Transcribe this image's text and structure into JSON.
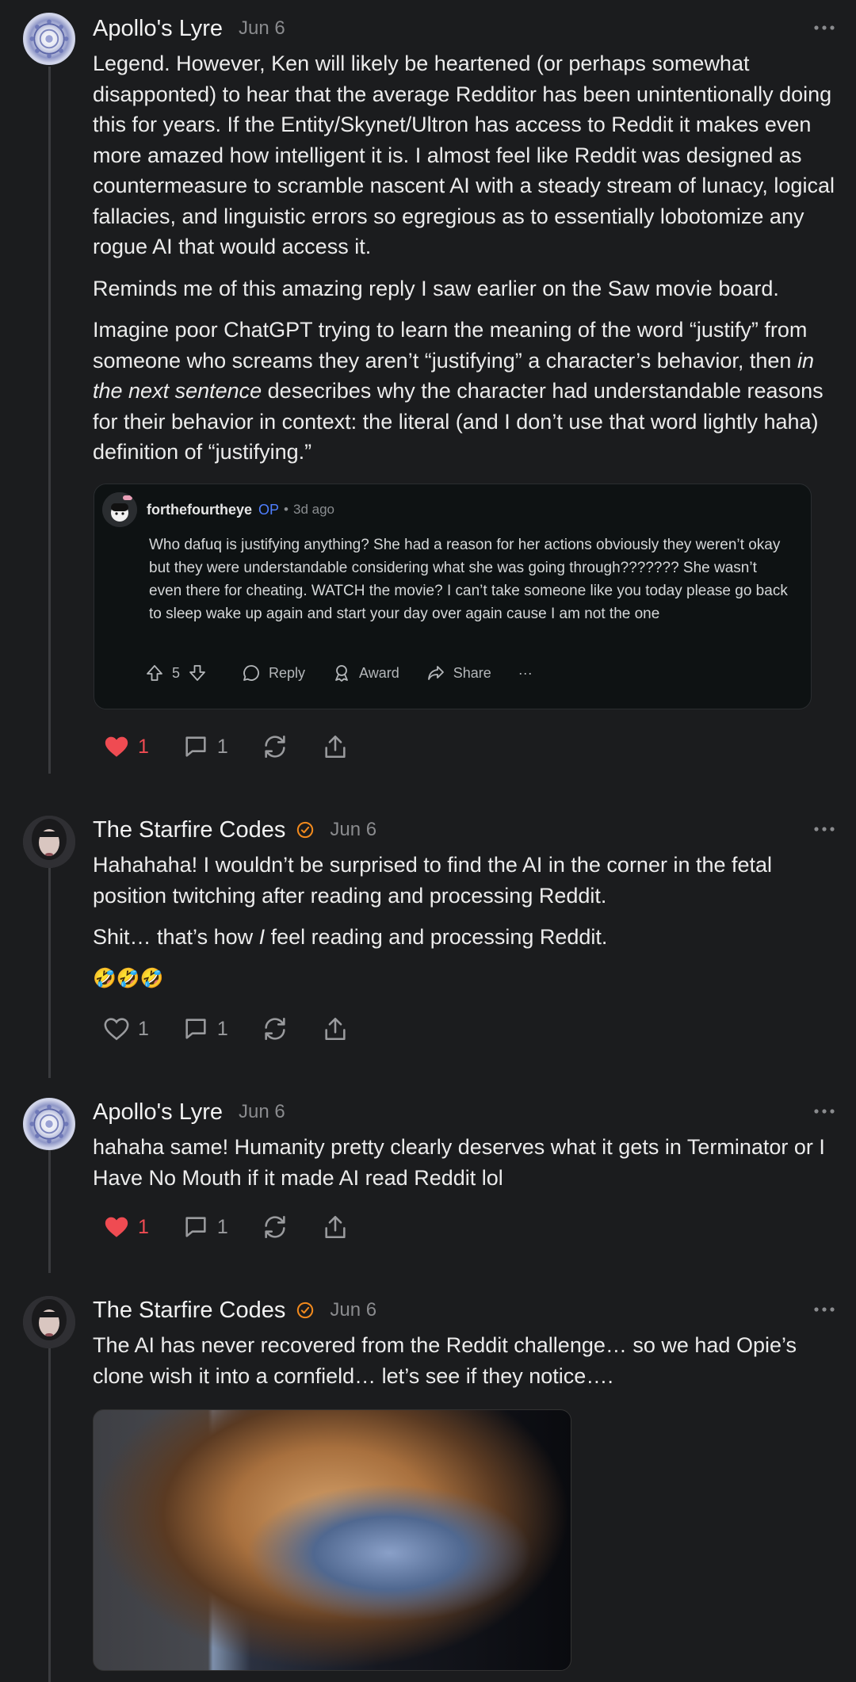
{
  "colors": {
    "background": "#1b1c1e",
    "like": "#ef4b52",
    "op": "#4f7fff",
    "verified": "#f28a1d"
  },
  "comments": [
    {
      "author": "Apollo's Lyre",
      "date": "Jun 6",
      "paragraphs": [
        "Legend. However, Ken will likely be heartened (or perhaps somewhat disapponted) to hear that the average Redditor has been unintentionally doing this for years. If the Entity/Skynet/Ultron has access to Reddit it makes even more amazed how intelligent it is. I almost feel like Reddit was designed as countermeasure to scramble nascent AI with a steady stream of lunacy, logical fallacies, and linguistic errors so egregious as to essentially lobotomize any rogue AI that would access it.",
        "Reminds me of this amazing reply I saw earlier on the Saw movie board."
      ],
      "p3_before": "Imagine poor ChatGPT trying to learn the meaning of the word “justify” from someone who screams they aren’t “justifying” a character’s behavior, then ",
      "p3_italic": "in the next sentence",
      "p3_after": " desecribes why the character had understandable reasons for their behavior in context: the literal (and I don’t use that word lightly haha) definition of “justifying.”",
      "likes": "1",
      "replies": "1",
      "liked": true
    },
    {
      "author": "The Starfire Codes",
      "date": "Jun 6",
      "p1": "Hahahaha! I wouldn’t be surprised to find the AI in the corner in the fetal position twitching after reading and processing Reddit.",
      "p2_before": "Shit… that’s how ",
      "p2_italic": "I",
      "p2_after": " feel reading and processing Reddit.",
      "emoji": "🤣🤣🤣",
      "likes": "1",
      "replies": "1",
      "liked": false
    },
    {
      "author": "Apollo's Lyre",
      "date": "Jun 6",
      "p1": "hahaha same! Humanity pretty clearly deserves what it gets in Terminator or I Have No Mouth if it made AI read Reddit lol",
      "likes": "1",
      "replies": "1",
      "liked": true
    },
    {
      "author": "The Starfire Codes",
      "date": "Jun 6",
      "p1": "The AI has never recovered from the Reddit challenge… so we had Opie’s clone wish it into a cornfield… let’s see if they notice…."
    }
  ],
  "embed": {
    "username": "forthefourtheye",
    "op_label": "OP",
    "separator": "•",
    "time": "3d ago",
    "text": "Who dafuq is justifying anything? She had a reason for her actions obviously they weren’t okay but they were understandable considering what she was going through??????? She wasn’t even there for cheating. WATCH the movie? I can’t take someone like you today please go back to sleep wake up again and start your day over again cause I am not the one",
    "votes": "5",
    "reply_label": "Reply",
    "award_label": "Award",
    "share_label": "Share",
    "more_label": "···"
  },
  "icons": [
    "more-icon",
    "heart-icon",
    "comment-icon",
    "restack-icon",
    "share-icon",
    "upvote-icon",
    "downvote-icon",
    "verified-icon"
  ]
}
